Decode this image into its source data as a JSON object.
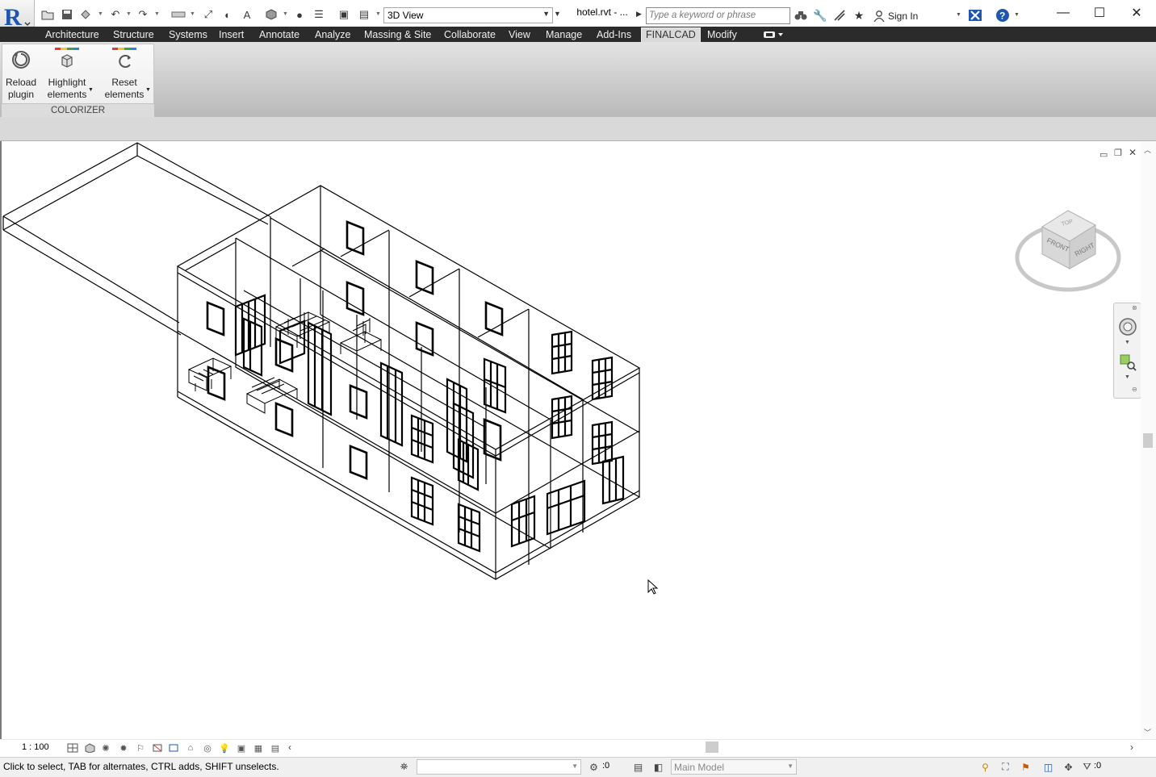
{
  "titlebar": {
    "view_selector": "3D View",
    "document_title": "hotel.rvt - ...",
    "search_placeholder": "Type a keyword or phrase",
    "sign_in": "Sign In"
  },
  "ribbon": {
    "tabs": [
      "Architecture",
      "Structure",
      "Systems",
      "Insert",
      "Annotate",
      "Analyze",
      "Massing & Site",
      "Collaborate",
      "View",
      "Manage",
      "Add-Ins",
      "FINALCAD",
      "Modify"
    ],
    "active_tab": "FINALCAD",
    "panel": {
      "title": "COLORIZER",
      "buttons": [
        {
          "line1": "Reload",
          "line2": "plugin",
          "icon": "reload-icon"
        },
        {
          "line1": "Highlight",
          "line2": "elements",
          "icon": "highlight-cube-icon"
        },
        {
          "line1": "Reset",
          "line2": "elements",
          "icon": "reset-icon"
        }
      ]
    }
  },
  "viewcube": {
    "top": "TOP",
    "front": "FRONT",
    "right": "RIGHT"
  },
  "view_control": {
    "scale": "1 : 100"
  },
  "status": {
    "message": "Click to select, TAB for alternates, CTRL adds, SHIFT unselects.",
    "worksharing_count": ":0",
    "model": "Main Model",
    "filter_count": ":0"
  },
  "colors": {
    "tab_bar": "#2b2b2b",
    "ribbon": "#c9c9c9",
    "revit_logo": "#1f57b0"
  }
}
